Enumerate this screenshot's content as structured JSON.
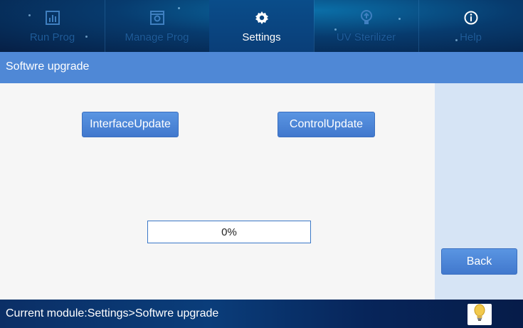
{
  "nav": {
    "tabs": [
      {
        "label": "Run Prog",
        "icon": "chart-icon",
        "active": false
      },
      {
        "label": "Manage Prog",
        "icon": "gear-box-icon",
        "active": false
      },
      {
        "label": "Settings",
        "icon": "gear-icon",
        "active": true
      },
      {
        "label": "UV Sterilizer",
        "icon": "uv-bulb-icon",
        "active": false
      },
      {
        "label": "Help",
        "icon": "info-icon",
        "active": false
      }
    ]
  },
  "page": {
    "title": "Softwre upgrade"
  },
  "buttons": {
    "interface_update": "InterfaceUpdate",
    "control_update": "ControlUpdate",
    "back": "Back"
  },
  "progress": {
    "value": 0,
    "text": "0%"
  },
  "status": {
    "text": "Current module:Settings>Softwre upgrade",
    "icon": "lightbulb-icon"
  },
  "colors": {
    "accent": "#4f88d6",
    "nav_bg": "#073b6e",
    "side_panel": "#d6e4f5"
  }
}
